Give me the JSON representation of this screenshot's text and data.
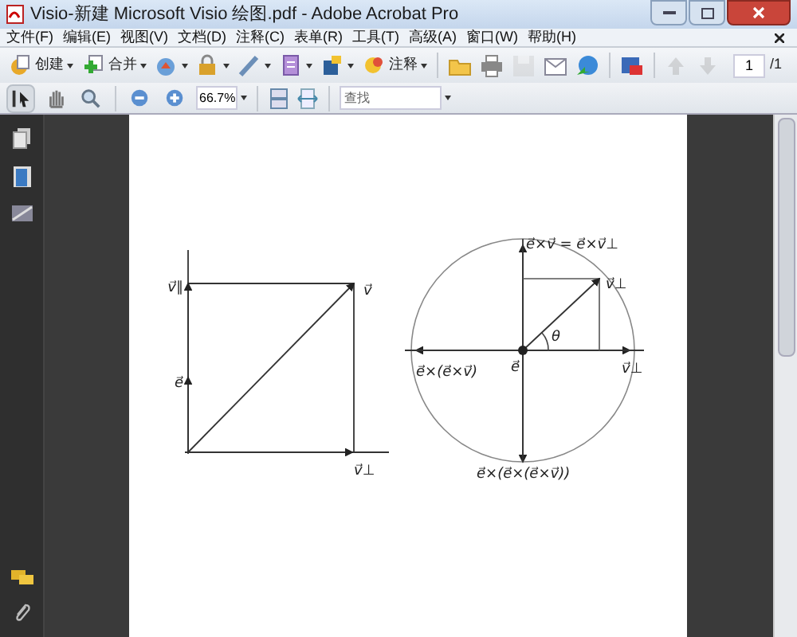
{
  "window": {
    "title": "Visio-新建 Microsoft Visio 绘图.pdf - Adobe Acrobat Pro"
  },
  "menu": [
    "文件(F)",
    "编辑(E)",
    "视图(V)",
    "文档(D)",
    "注释(C)",
    "表单(R)",
    "工具(T)",
    "高级(A)",
    "窗口(W)",
    "帮助(H)"
  ],
  "toolbar": [
    {
      "label": "创建",
      "dropdown": true,
      "disabled": false
    },
    {
      "label": "合并",
      "dropdown": true,
      "disabled": false
    },
    {
      "dropdown": true,
      "disabled": false
    },
    {
      "dropdown": true,
      "disabled": false
    },
    {
      "dropdown": true,
      "disabled": false
    },
    {
      "dropdown": true,
      "disabled": false
    },
    {
      "dropdown": true,
      "disabled": false
    },
    {
      "label": "注释",
      "dropdown": true,
      "disabled": false
    },
    {
      "dropdown": false,
      "disabled": false
    },
    {
      "dropdown": false,
      "disabled": false
    },
    {
      "dropdown": false,
      "disabled": true
    },
    {
      "dropdown": false,
      "disabled": false
    },
    {
      "dropdown": false,
      "disabled": false
    },
    {
      "dropdown": false,
      "disabled": false
    },
    {
      "dropdown": false,
      "disabled": true
    },
    {
      "dropdown": false,
      "disabled": true
    }
  ],
  "page_nav": {
    "value": "1",
    "total": "/1"
  },
  "toolbar2": [
    {
      "selected": true
    },
    {
      "selected": false
    },
    {
      "selected": false
    },
    {
      "selected": false
    },
    {
      "selected": false
    }
  ],
  "zoom": {
    "value": "66.7%"
  },
  "search": {
    "placeholder": "查找"
  },
  "diagram": {
    "left": [
      "v⃗∥",
      "v⃗",
      "e⃗",
      "v⃗⊥"
    ],
    "right": [
      "e⃗×v⃗ = e⃗×v⃗⊥",
      "v⃗⊥",
      "θ",
      "e⃗×(e⃗×v⃗)",
      "e⃗",
      "v⃗⊥",
      "e⃗×(e⃗×(e⃗×v⃗))"
    ]
  }
}
